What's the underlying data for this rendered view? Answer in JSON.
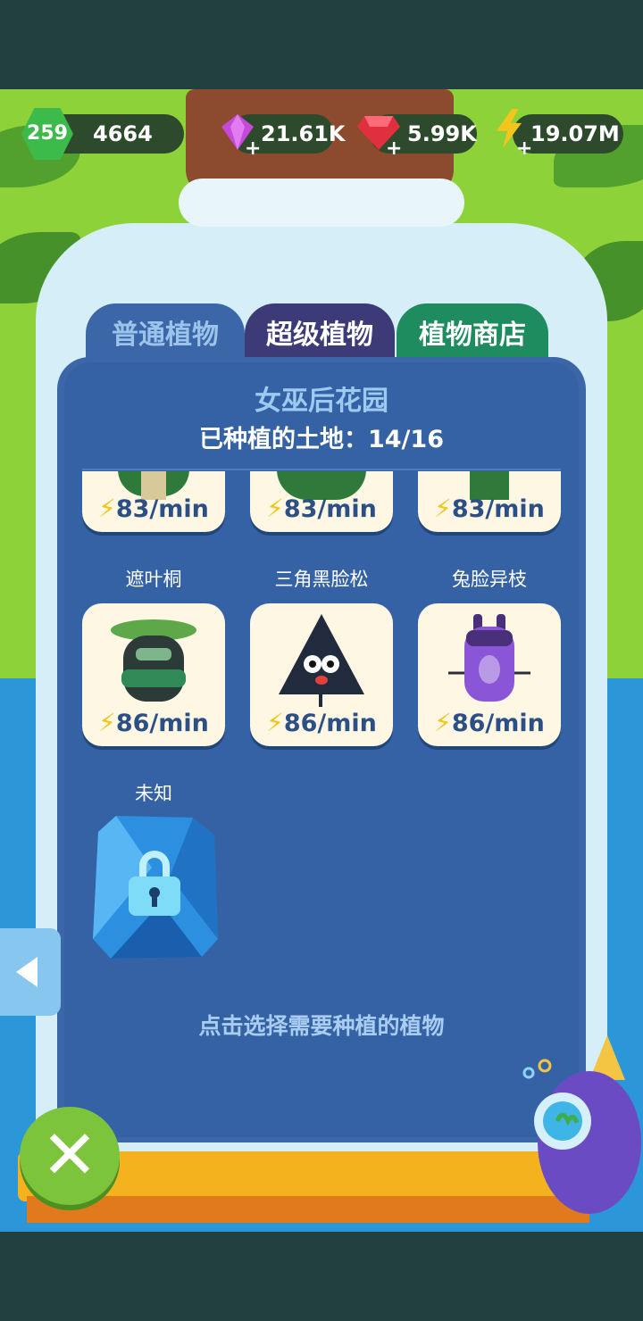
{
  "top_bar": {
    "level": "259",
    "experience": "4664",
    "purple_gems": "21.61K",
    "red_gems": "5.99K",
    "energy": "19.07M"
  },
  "tabs": [
    {
      "label": "普通植物",
      "active": true
    },
    {
      "label": "超级植物",
      "active": false
    },
    {
      "label": "植物商店",
      "active": false
    }
  ],
  "garden": {
    "title": "女巫后花园",
    "planted_label": "已种植的土地：14/16"
  },
  "plants": [
    {
      "name": "",
      "rate": "83/min"
    },
    {
      "name": "",
      "rate": "83/min"
    },
    {
      "name": "",
      "rate": "83/min"
    },
    {
      "name": "遮叶桐",
      "rate": "86/min"
    },
    {
      "name": "三角黑脸松",
      "rate": "86/min"
    },
    {
      "name": "兔脸异枝",
      "rate": "86/min"
    }
  ],
  "locked_plant": {
    "name": "未知"
  },
  "hint": "点击选择需要种植的植物",
  "colors": {
    "accent_green": "#7cc43b",
    "panel_blue": "#3462a4",
    "energy_yellow": "#f2c51b"
  },
  "icons": [
    "back-arrow-icon",
    "close-icon",
    "lock-icon",
    "lightning-icon",
    "purple-gem-icon",
    "red-gem-icon"
  ]
}
